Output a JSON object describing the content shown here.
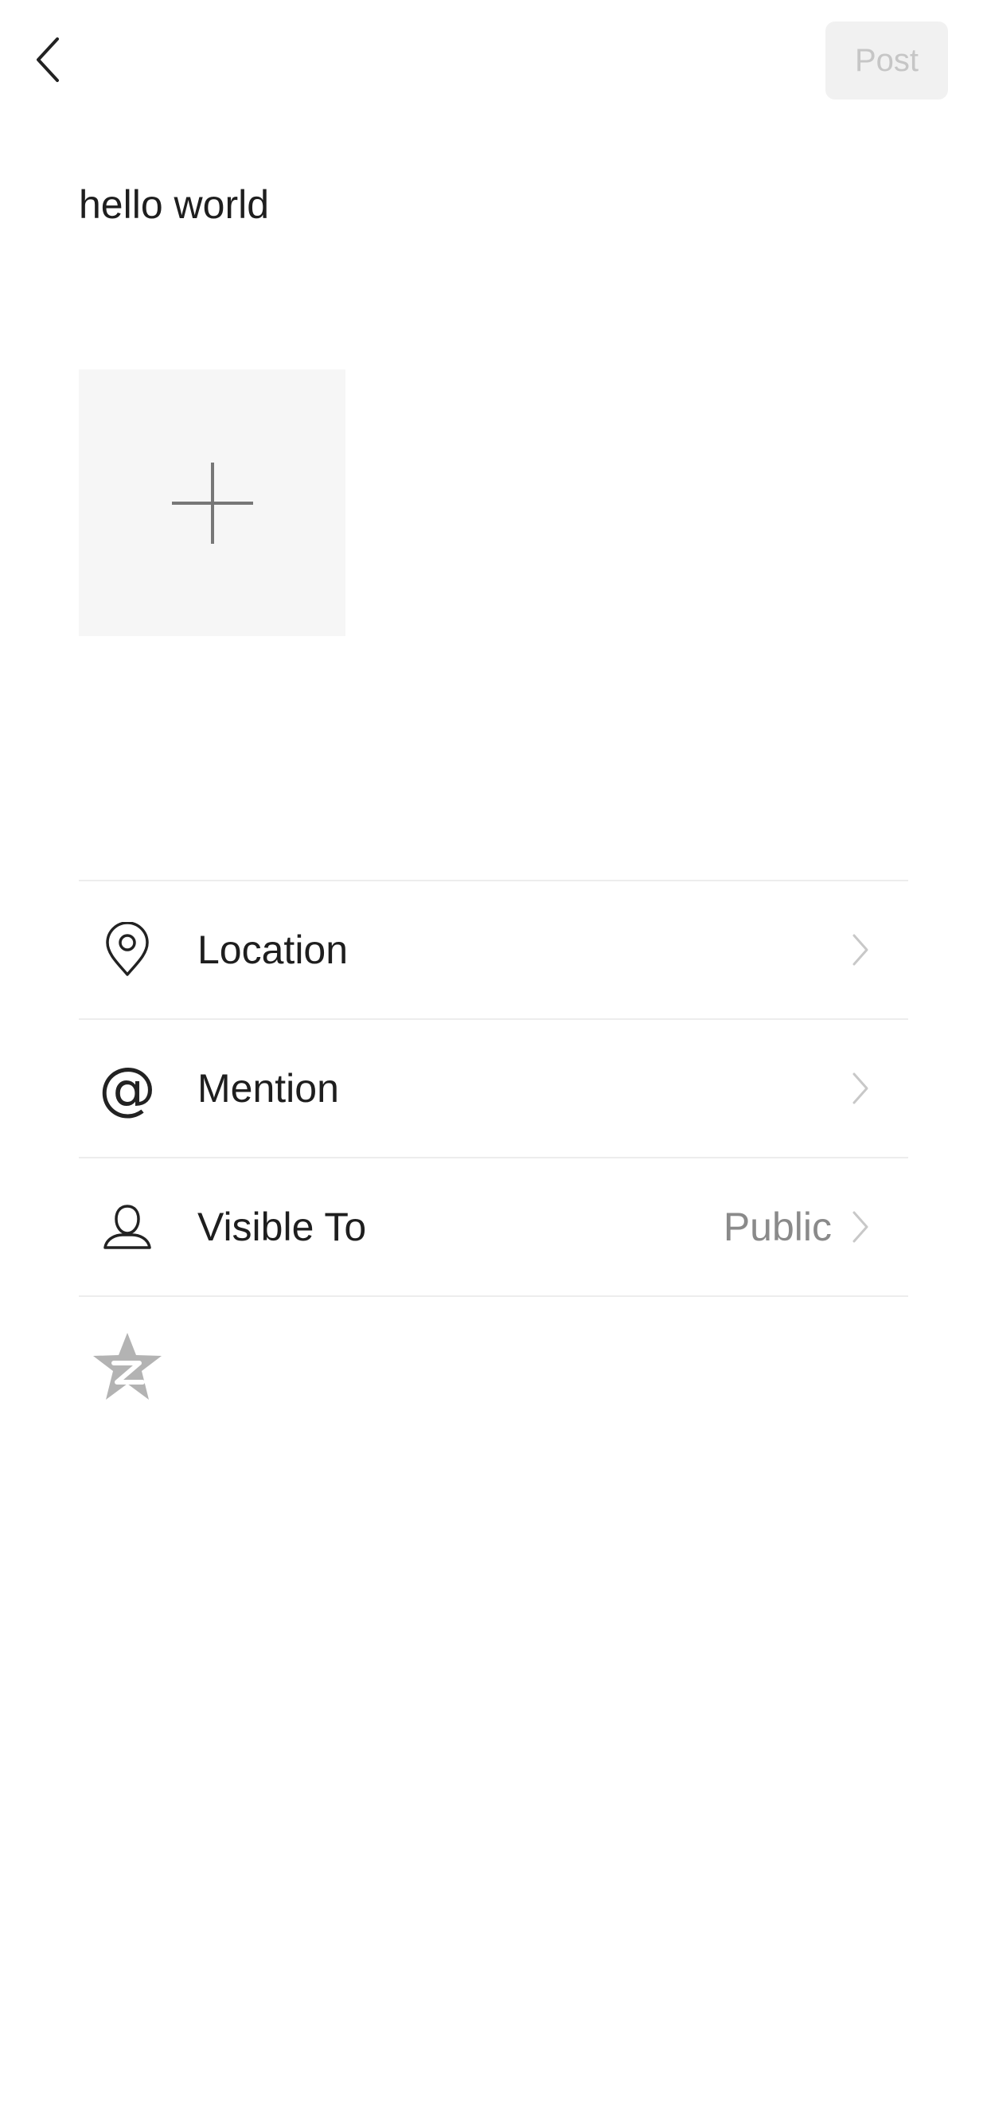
{
  "header": {
    "back_icon": "chevron-left-icon",
    "post_label": "Post"
  },
  "composer": {
    "text": "hello world",
    "add_photo_icon": "plus-icon"
  },
  "options": {
    "location": {
      "label": "Location",
      "icon": "location-pin-icon"
    },
    "mention": {
      "label": "Mention",
      "icon": "at-icon",
      "glyph": "@"
    },
    "visible_to": {
      "label": "Visible To",
      "value": "Public",
      "icon": "person-icon"
    }
  },
  "share": {
    "qzone_icon": "qzone-star-icon"
  },
  "colors": {
    "post_bg": "#f1f1f1",
    "post_text": "#c6c6c6",
    "divider": "#ededed",
    "photo_tile": "#f6f6f6",
    "value_text": "#8a8a8a"
  }
}
